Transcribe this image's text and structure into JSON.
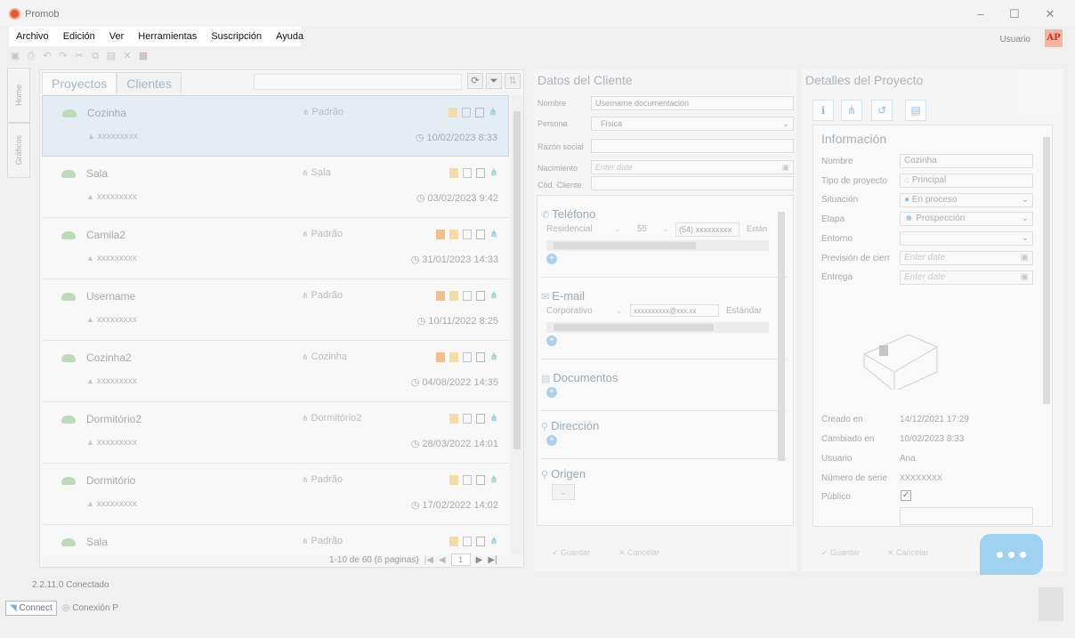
{
  "window": {
    "title": "Promob",
    "minimize": "–",
    "maximize": "☐",
    "close": "✕"
  },
  "menu": [
    "Archivo",
    "Edición",
    "Ver",
    "Herramientas",
    "Suscripción",
    "Ayuda"
  ],
  "header": {
    "user_label": "Usuario",
    "user_initials": "AP"
  },
  "side_tabs": [
    "Home",
    "Gráficos"
  ],
  "projects": {
    "tabs": [
      "Proyectos",
      "Clientes"
    ],
    "rows": [
      {
        "name": "Cozinha",
        "tag": "Padrão",
        "user": "xxxxxxxxx",
        "date": "10/02/2023 8:33",
        "has_person": false
      },
      {
        "name": "Sala",
        "tag": "Sala",
        "user": "xxxxxxxxx",
        "date": "03/02/2023 9:42",
        "has_person": false
      },
      {
        "name": "Camila2",
        "tag": "Padrão",
        "user": "xxxxxxxxx",
        "date": "31/01/2023 14:33",
        "has_person": true
      },
      {
        "name": "Username",
        "tag": "Padrão",
        "user": "xxxxxxxxx",
        "date": "10/11/2022 8:25",
        "has_person": true
      },
      {
        "name": "Cozinha2",
        "tag": "Cozinha",
        "user": "xxxxxxxxx",
        "date": "04/08/2022 14:35",
        "has_person": true
      },
      {
        "name": "Dormitório2",
        "tag": "Dormitório2",
        "user": "xxxxxxxxx",
        "date": "28/03/2022 14:01",
        "has_person": false
      },
      {
        "name": "Dormitório",
        "tag": "Padrão",
        "user": "xxxxxxxxx",
        "date": "17/02/2022 14:02",
        "has_person": false
      },
      {
        "name": "Sala",
        "tag": "Padrão",
        "user": "",
        "date": "",
        "has_person": false
      }
    ],
    "pager": {
      "summary": "1-10 de 60 (6 paginas)",
      "page": "1"
    }
  },
  "client": {
    "title": "Datos del Cliente",
    "fields": {
      "nombre_label": "Nombre",
      "nombre_value": "Username documentación",
      "persona_label": "Persona",
      "persona_value": "Física",
      "razon_label": "Razón social",
      "nacimiento_label": "Nacimiento",
      "nacimiento_placeholder": "Enter date",
      "cod_label": "Cód. Cliente"
    },
    "telefono": {
      "title": "Teléfono",
      "type": "Residencial",
      "code": "55",
      "number": "(54) xxxxxxxxx",
      "status": "Están"
    },
    "email": {
      "title": "E-mail",
      "type": "Corporativo",
      "address": "xxxxxxxxxx@xxx.xx",
      "status": "Estándar"
    },
    "documentos": "Documentos",
    "direccion": "Dirección",
    "origen": "Origen",
    "footer": {
      "save": "Guardar",
      "cancel": "Cancelar"
    }
  },
  "detail": {
    "title": "Detalles del Proyecto",
    "section": "Información",
    "fields": {
      "nombre_label": "Nombre",
      "nombre_value": "Cozinha",
      "tipo_label": "Tipo de proyecto",
      "tipo_value": "Principal",
      "situacion_label": "Situación",
      "situacion_value": "En proceso",
      "etapa_label": "Etapa",
      "etapa_value": "Prospección",
      "entorno_label": "Entorno",
      "prevision_label": "Previsión de cierr",
      "prevision_placeholder": "Enter date",
      "entrega_label": "Entrega",
      "entrega_placeholder": "Enter date",
      "creado_label": "Creado en",
      "creado_value": "14/12/2021 17:29",
      "cambiado_label": "Cambiado en",
      "cambiado_value": "10/02/2023 8:33",
      "usuario_label": "Usuario",
      "usuario_value": "Ana",
      "serie_label": "Número de serie",
      "serie_value": "XXXXXXXX",
      "publico_label": "Público"
    },
    "footer": {
      "save": "Guardar",
      "cancel": "Cancelar"
    }
  },
  "status": {
    "version": "2.2.11.0 Conectado",
    "connect": "Connect",
    "conexion": "Conexión P"
  }
}
